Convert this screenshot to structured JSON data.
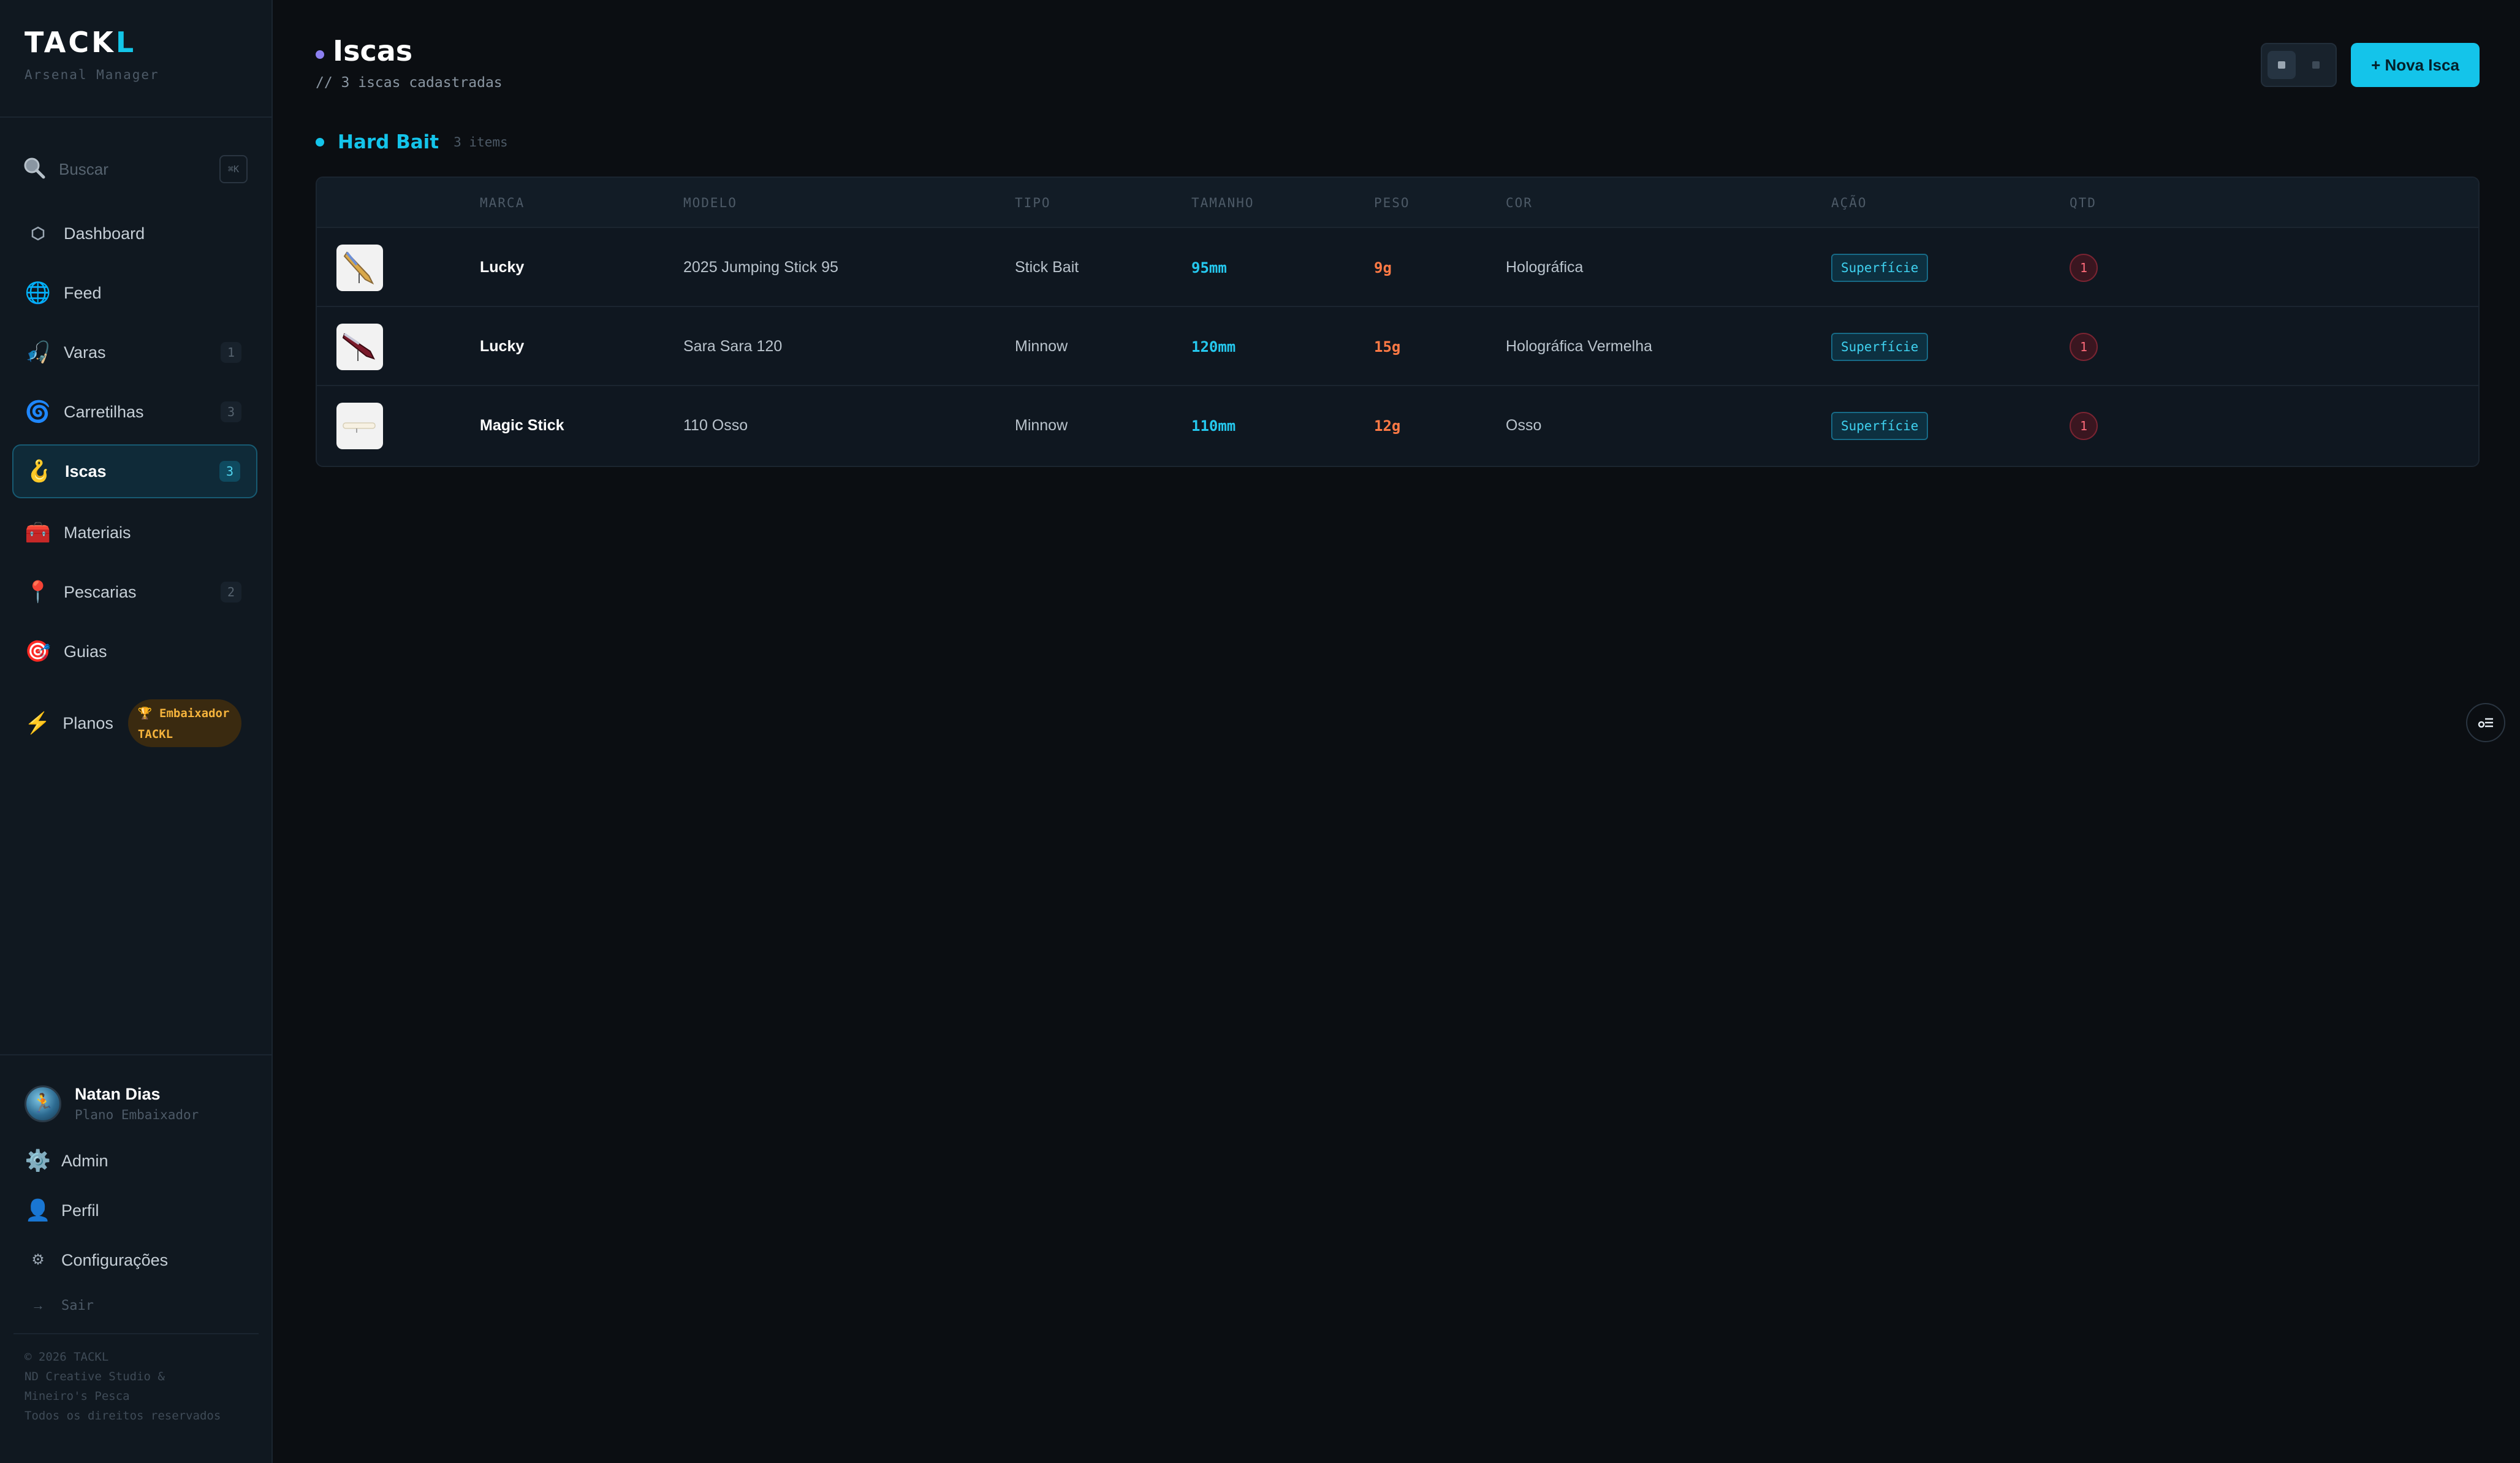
{
  "sidebar": {
    "logo_main": "TACK",
    "logo_accent": "L",
    "subtitle": "Arsenal Manager",
    "search": {
      "label": "Buscar",
      "shortcut": "⌘K"
    },
    "nav": [
      {
        "label": "Dashboard",
        "icon": "dashboard-icon",
        "count": ""
      },
      {
        "label": "Feed",
        "icon": "globe-icon",
        "count": ""
      },
      {
        "label": "Varas",
        "icon": "fishing-rod-icon",
        "count": "1"
      },
      {
        "label": "Carretilhas",
        "icon": "reel-icon",
        "count": "3"
      },
      {
        "label": "Iscas",
        "icon": "hook-icon",
        "count": "3"
      },
      {
        "label": "Materiais",
        "icon": "toolbox-icon",
        "count": ""
      },
      {
        "label": "Pescarias",
        "icon": "pin-icon",
        "count": "2"
      },
      {
        "label": "Guias",
        "icon": "target-icon",
        "count": ""
      }
    ],
    "plans": {
      "label": "Planos",
      "badge_line1": "🏆 Embaixador",
      "badge_line2": "TACKL"
    },
    "user": {
      "name": "Natan Dias",
      "plan": "Plano Embaixador"
    },
    "bottom_nav": {
      "admin": "Admin",
      "profile": "Perfil",
      "settings": "Configurações",
      "logout": "Sair"
    },
    "footer": [
      "© 2026 TACKL",
      "ND Creative Studio &",
      "Mineiro's Pesca",
      "Todos os direitos reservados"
    ]
  },
  "header": {
    "title": "Iscas",
    "subtitle": "// 3 iscas cadastradas",
    "new_button": "+ Nova Isca"
  },
  "group": {
    "title": "Hard Bait",
    "count": "3 items"
  },
  "table": {
    "columns": [
      "MARCA",
      "MODELO",
      "TIPO",
      "TAMANHO",
      "PESO",
      "COR",
      "AÇÃO",
      "QTD"
    ],
    "rows": [
      {
        "brand": "Lucky",
        "model": "2025 Jumping Stick 95",
        "type": "Stick Bait",
        "size": "95mm",
        "weight": "9g",
        "color": "Holográfica",
        "action": "Superfície",
        "qty": "1"
      },
      {
        "brand": "Lucky",
        "model": "Sara Sara 120",
        "type": "Minnow",
        "size": "120mm",
        "weight": "15g",
        "color": "Holográfica Vermelha",
        "action": "Superfície",
        "qty": "1"
      },
      {
        "brand": "Magic Stick",
        "model": "110 Osso",
        "type": "Minnow",
        "size": "110mm",
        "weight": "12g",
        "color": "Osso",
        "action": "Superfície",
        "qty": "1"
      }
    ]
  },
  "colors": {
    "accent": "#14c4ea",
    "size_text": "#25c8ee",
    "weight_text": "#ff7a45",
    "plan_badge": "#f5b33c",
    "qty_badge": "#ff6b7a"
  }
}
